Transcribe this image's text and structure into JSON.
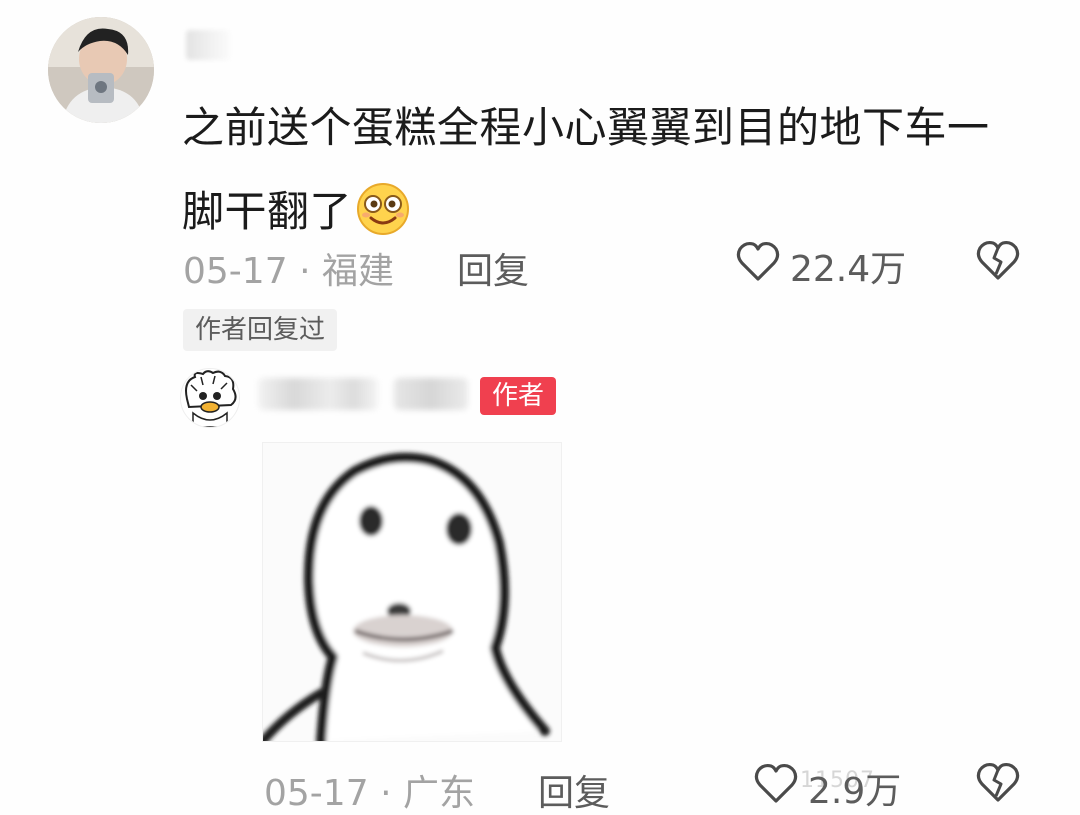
{
  "comment": {
    "text_line1": "之前送个蛋糕全程小心翼翼到目的地下车一",
    "text_line2": "脚干翻了",
    "emoji": "smiley-face-emoji",
    "date": "05-17",
    "separator": "·",
    "location": "福建",
    "reply_label": "回复",
    "like_count": "22.4万",
    "author_replied_label": "作者回复过"
  },
  "reply": {
    "author_tag": "作者",
    "sticker": "blurry-penguin-meme-sticker",
    "date": "05-17",
    "separator": "·",
    "location": "广东",
    "reply_label": "回复",
    "like_count": "2.9万",
    "watermark": "11507"
  },
  "colors": {
    "author_tag_bg": "#f0404f",
    "meta_gray": "#a3a3a3",
    "text": "#1b1b1b"
  }
}
